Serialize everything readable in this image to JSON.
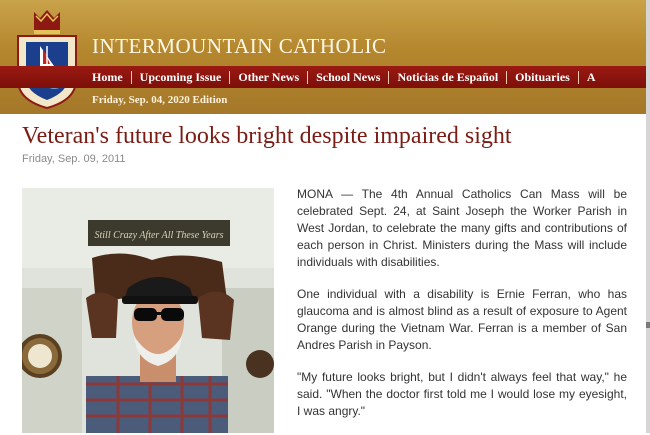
{
  "site": {
    "title": "INTERMOUNTAIN CATHOLIC",
    "edition": "Friday, Sep. 04, 2020 Edition"
  },
  "nav": {
    "items": [
      "Home",
      "Upcoming Issue",
      "Other News",
      "School News",
      "Noticias de Español",
      "Obituaries",
      "A"
    ]
  },
  "article": {
    "title": "Veteran's future looks bright despite impaired sight",
    "date": "Friday, Sep. 09, 2011",
    "paragraphs": [
      "MONA — The 4th Annual Catholics Can Mass will be celebrated Sept. 24, at Saint Joseph the Worker Parish in West Jordan, to celebrate the many gifts and contributions of each person in Christ. Ministers during the Mass will include individuals with disabilities.",
      "One individual with a disability is Ernie Ferran, who has glaucoma and is almost blind as a result of exposure to Agent Orange during the Vietnam War. Ferran is a member of San Andres Parish in Payson.",
      "\"My future looks bright, but I didn't always feel that way,\" he said. \"When the doctor first told me I would lose my eyesight, I was angry.\""
    ],
    "photo_sign": "Still Crazy After All These Years"
  },
  "colors": {
    "header_gold": "#b4862d",
    "nav_red": "#8a1610",
    "title_red": "#7a1c14",
    "text": "#333333"
  }
}
